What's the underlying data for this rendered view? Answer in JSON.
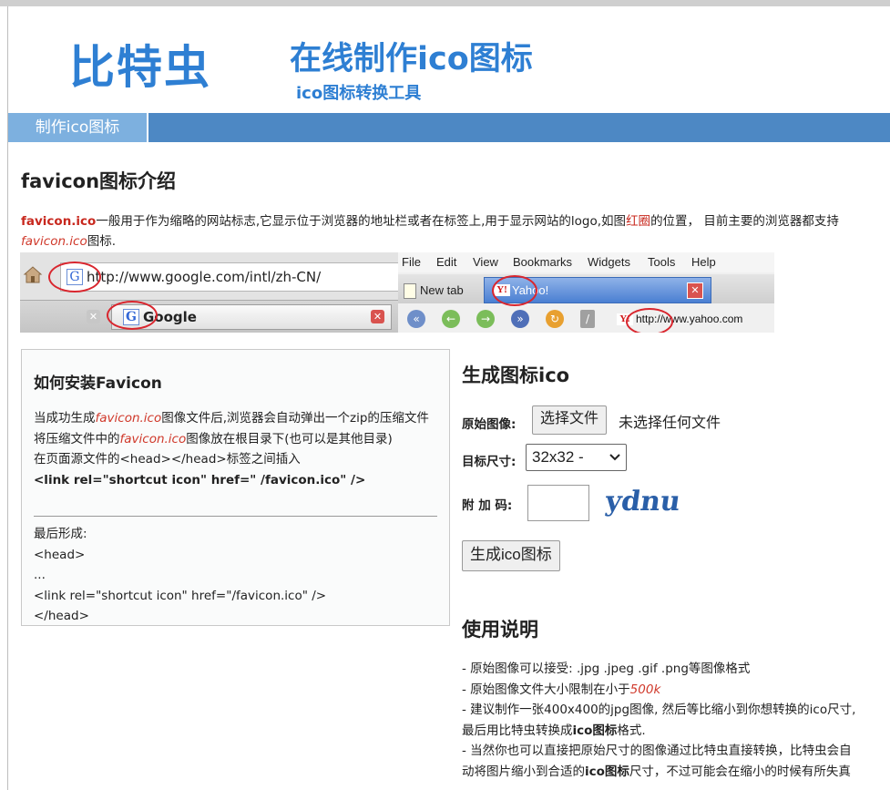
{
  "header": {
    "logo": "比特虫",
    "title": "在线制作ico图标",
    "subtitle": "ico图标转换工具"
  },
  "nav": {
    "active_tab": "制作ico图标"
  },
  "intro": {
    "title": "favicon图标介绍",
    "p_term": "favicon.ico",
    "p_text1": "一般用于作为缩略的网站标志,它显示位于浏览器的地址栏或者在标签上,用于显示网站的logo,如图",
    "p_red": "红圈",
    "p_text2": "的位置， 目前主要的浏览器都支持",
    "p_term2": "favicon.ico",
    "p_text3": "图标."
  },
  "screenshot": {
    "google_url": "http://www.google.com/intl/zh-CN/",
    "google_tab": "Google",
    "menu": [
      "File",
      "Edit",
      "View",
      "Bookmarks",
      "Widgets",
      "Tools",
      "Help"
    ],
    "new_tab": "New tab",
    "yahoo_tab": "Yahoo!",
    "yahoo_url": "http://www.yahoo.com"
  },
  "install": {
    "title": "如何安装Favicon",
    "line1_a": "当成功生成",
    "line1_term": "favicon.ico",
    "line1_b": "图像文件后,浏览器会自动弹出一个zip的压缩文件",
    "line2_a": "将压缩文件中的",
    "line2_term": "favicon.ico",
    "line2_b": "图像放在根目录下(也可以是其他目录)",
    "line3": "在页面源文件的<head></head>标签之间插入",
    "code": "<link rel=\"shortcut icon\" href=\" /favicon.ico\" />",
    "after_label": "最后形成:",
    "after_1": "<head>",
    "after_2": "...",
    "after_3": "<link rel=\"shortcut icon\" href=\"/favicon.ico\" />",
    "after_4": "</head>"
  },
  "form": {
    "title": "生成图标ico",
    "image_label": "原始图像:",
    "file_button": "选择文件",
    "file_status": "未选择任何文件",
    "size_label": "目标尺寸:",
    "size_value": "32x32 -",
    "code_label": "附 加 码:",
    "captcha": "ydnu",
    "submit": "生成ico图标"
  },
  "usage": {
    "title": "使用说明",
    "l1": "- 原始图像可以接受: .jpg .jpeg .gif .png等图像格式",
    "l2_a": "- 原始图像文件大小限制在小于",
    "l2_red": "500k",
    "l3_a": "- 建议制作一张400x400的jpg图像, 然后等比缩小到你想转换的ico尺寸,最后用比特虫转换成",
    "l3_bold": "ico图标",
    "l3_b": "格式.",
    "l4_a": "- 当然你也可以直接把原始尺寸的图像通过比特虫直接转换，比特虫会自动将图片缩小到合适的",
    "l4_bold": "ico图标",
    "l4_b": "尺寸，不过可能会在缩小的时候有所失真"
  },
  "colors": {
    "brand_blue": "#2e7fd3",
    "nav_bar": "#4d88c4",
    "nav_tab": "#7db0df",
    "highlight_red": "#c8281e"
  }
}
